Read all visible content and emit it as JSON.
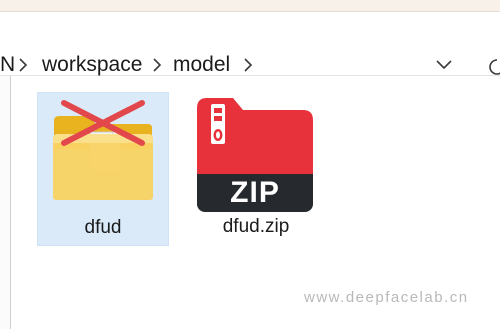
{
  "breadcrumb": {
    "partial": "N",
    "items": [
      "workspace",
      "model"
    ]
  },
  "files": [
    {
      "name": "dfud",
      "type": "folder",
      "selected": true
    },
    {
      "name": "dfud.zip",
      "type": "zip",
      "icon_text": "ZIP"
    }
  ],
  "watermark": "www.deepfacelab.cn",
  "colors": {
    "selection": "#dbeaf8",
    "folder": "#f5c542",
    "zip_red": "#e7323c",
    "zip_dark": "#262a2e",
    "x_mark": "#e2474b"
  }
}
